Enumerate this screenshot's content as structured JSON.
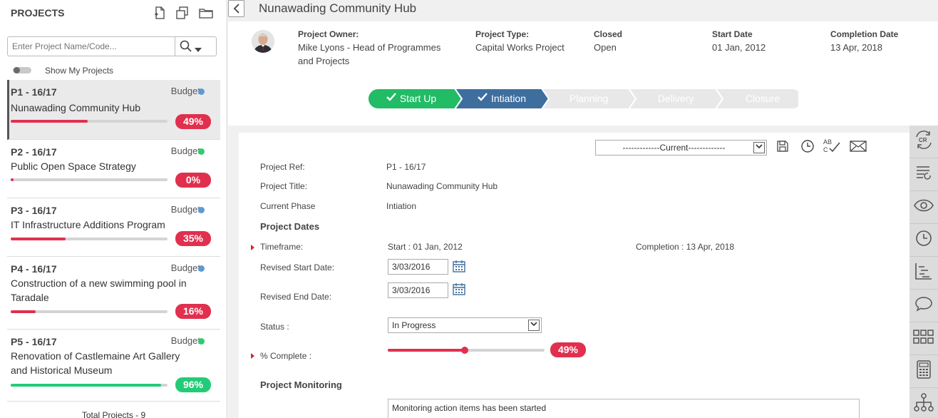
{
  "left_panel": {
    "title": "PROJECTS",
    "search_placeholder": "Enter Project Name/Code...",
    "show_my_projects": "Show My Projects",
    "total": "Total Projects - 9",
    "projects": [
      {
        "code": "P1 - 16/17",
        "budget": "Budget",
        "dot_color": "#5b9bd5",
        "name": "Nunawading Community Hub",
        "pct_label": "49%",
        "progress": 0.49,
        "bar_color": "#e0304e"
      },
      {
        "code": "P2 - 16/17",
        "budget": "Budget",
        "dot_color": "#2ecc71",
        "name": "Public Open Space Strategy",
        "pct_label": "0%",
        "progress": 0.02,
        "bar_color": "#e0304e"
      },
      {
        "code": "P3 - 16/17",
        "budget": "Budget",
        "dot_color": "#5b9bd5",
        "name": "IT Infrastructure Additions Program",
        "pct_label": "35%",
        "progress": 0.35,
        "bar_color": "#e0304e"
      },
      {
        "code": "P4 - 16/17",
        "budget": "Budget",
        "dot_color": "#5b9bd5",
        "name": "Construction of a new swimming pool in Taradale",
        "pct_label": "16%",
        "progress": 0.16,
        "bar_color": "#e0304e"
      },
      {
        "code": "P5 - 16/17",
        "budget": "Budget",
        "dot_color": "#2ecc71",
        "name": "Renovation of Castlemaine Art Gallery and Historical Museum",
        "pct_label": "96%",
        "progress": 0.96,
        "bar_color": "#22cc77"
      }
    ]
  },
  "project": {
    "title": "Nunawading Community Hub",
    "owner_label": "Project Owner:",
    "owner_value": "Mike Lyons - Head of Programmes and Projects",
    "type_label": "Project Type:",
    "type_value": "Capital Works Project",
    "closed_label": "Closed",
    "closed_value": "Open",
    "start_label": "Start Date",
    "start_value": "01 Jan, 2012",
    "completion_label": "Completion Date",
    "completion_value": "13 Apr, 2018"
  },
  "phases": [
    {
      "label": "Start Up",
      "state": "done",
      "color": "#22bb66"
    },
    {
      "label": "Intiation",
      "state": "current",
      "color": "#3e6e9e"
    },
    {
      "label": "Planning",
      "state": "todo",
      "color": "#e8e8e8"
    },
    {
      "label": "Delivery",
      "state": "todo",
      "color": "#e8e8e8"
    },
    {
      "label": "Closure",
      "state": "todo",
      "color": "#e8e8e8"
    }
  ],
  "form": {
    "version_select": "-------------Current-------------",
    "ref_label": "Project Ref:",
    "ref_value": "P1 - 16/17",
    "title_label": "Project Title:",
    "title_value": "Nunawading Community Hub",
    "phase_label": "Current Phase",
    "phase_value": "Intiation",
    "dates_heading": "Project Dates",
    "timeframe_label": "Timeframe:",
    "timeframe_start": "Start : 01 Jan, 2012",
    "timeframe_completion": "Completion : 13 Apr, 2018",
    "revised_start_label": "Revised Start Date:",
    "revised_start_value": "3/03/2016",
    "revised_end_label": "Revised End Date:",
    "revised_end_value": "3/03/2016",
    "status_label": "Status :",
    "status_value": "In Progress",
    "complete_label": "% Complete :",
    "complete_pct": "49%",
    "complete_fraction": 0.49,
    "monitoring_heading": "Project Monitoring",
    "monitoring_text": "Monitoring action items has been started"
  },
  "sidebar_icons": [
    "change-request-icon",
    "task-refresh-icon",
    "eye-icon",
    "clock-icon",
    "gantt-icon",
    "comment-icon",
    "grid-icon",
    "calculator-icon",
    "hierarchy-icon"
  ]
}
